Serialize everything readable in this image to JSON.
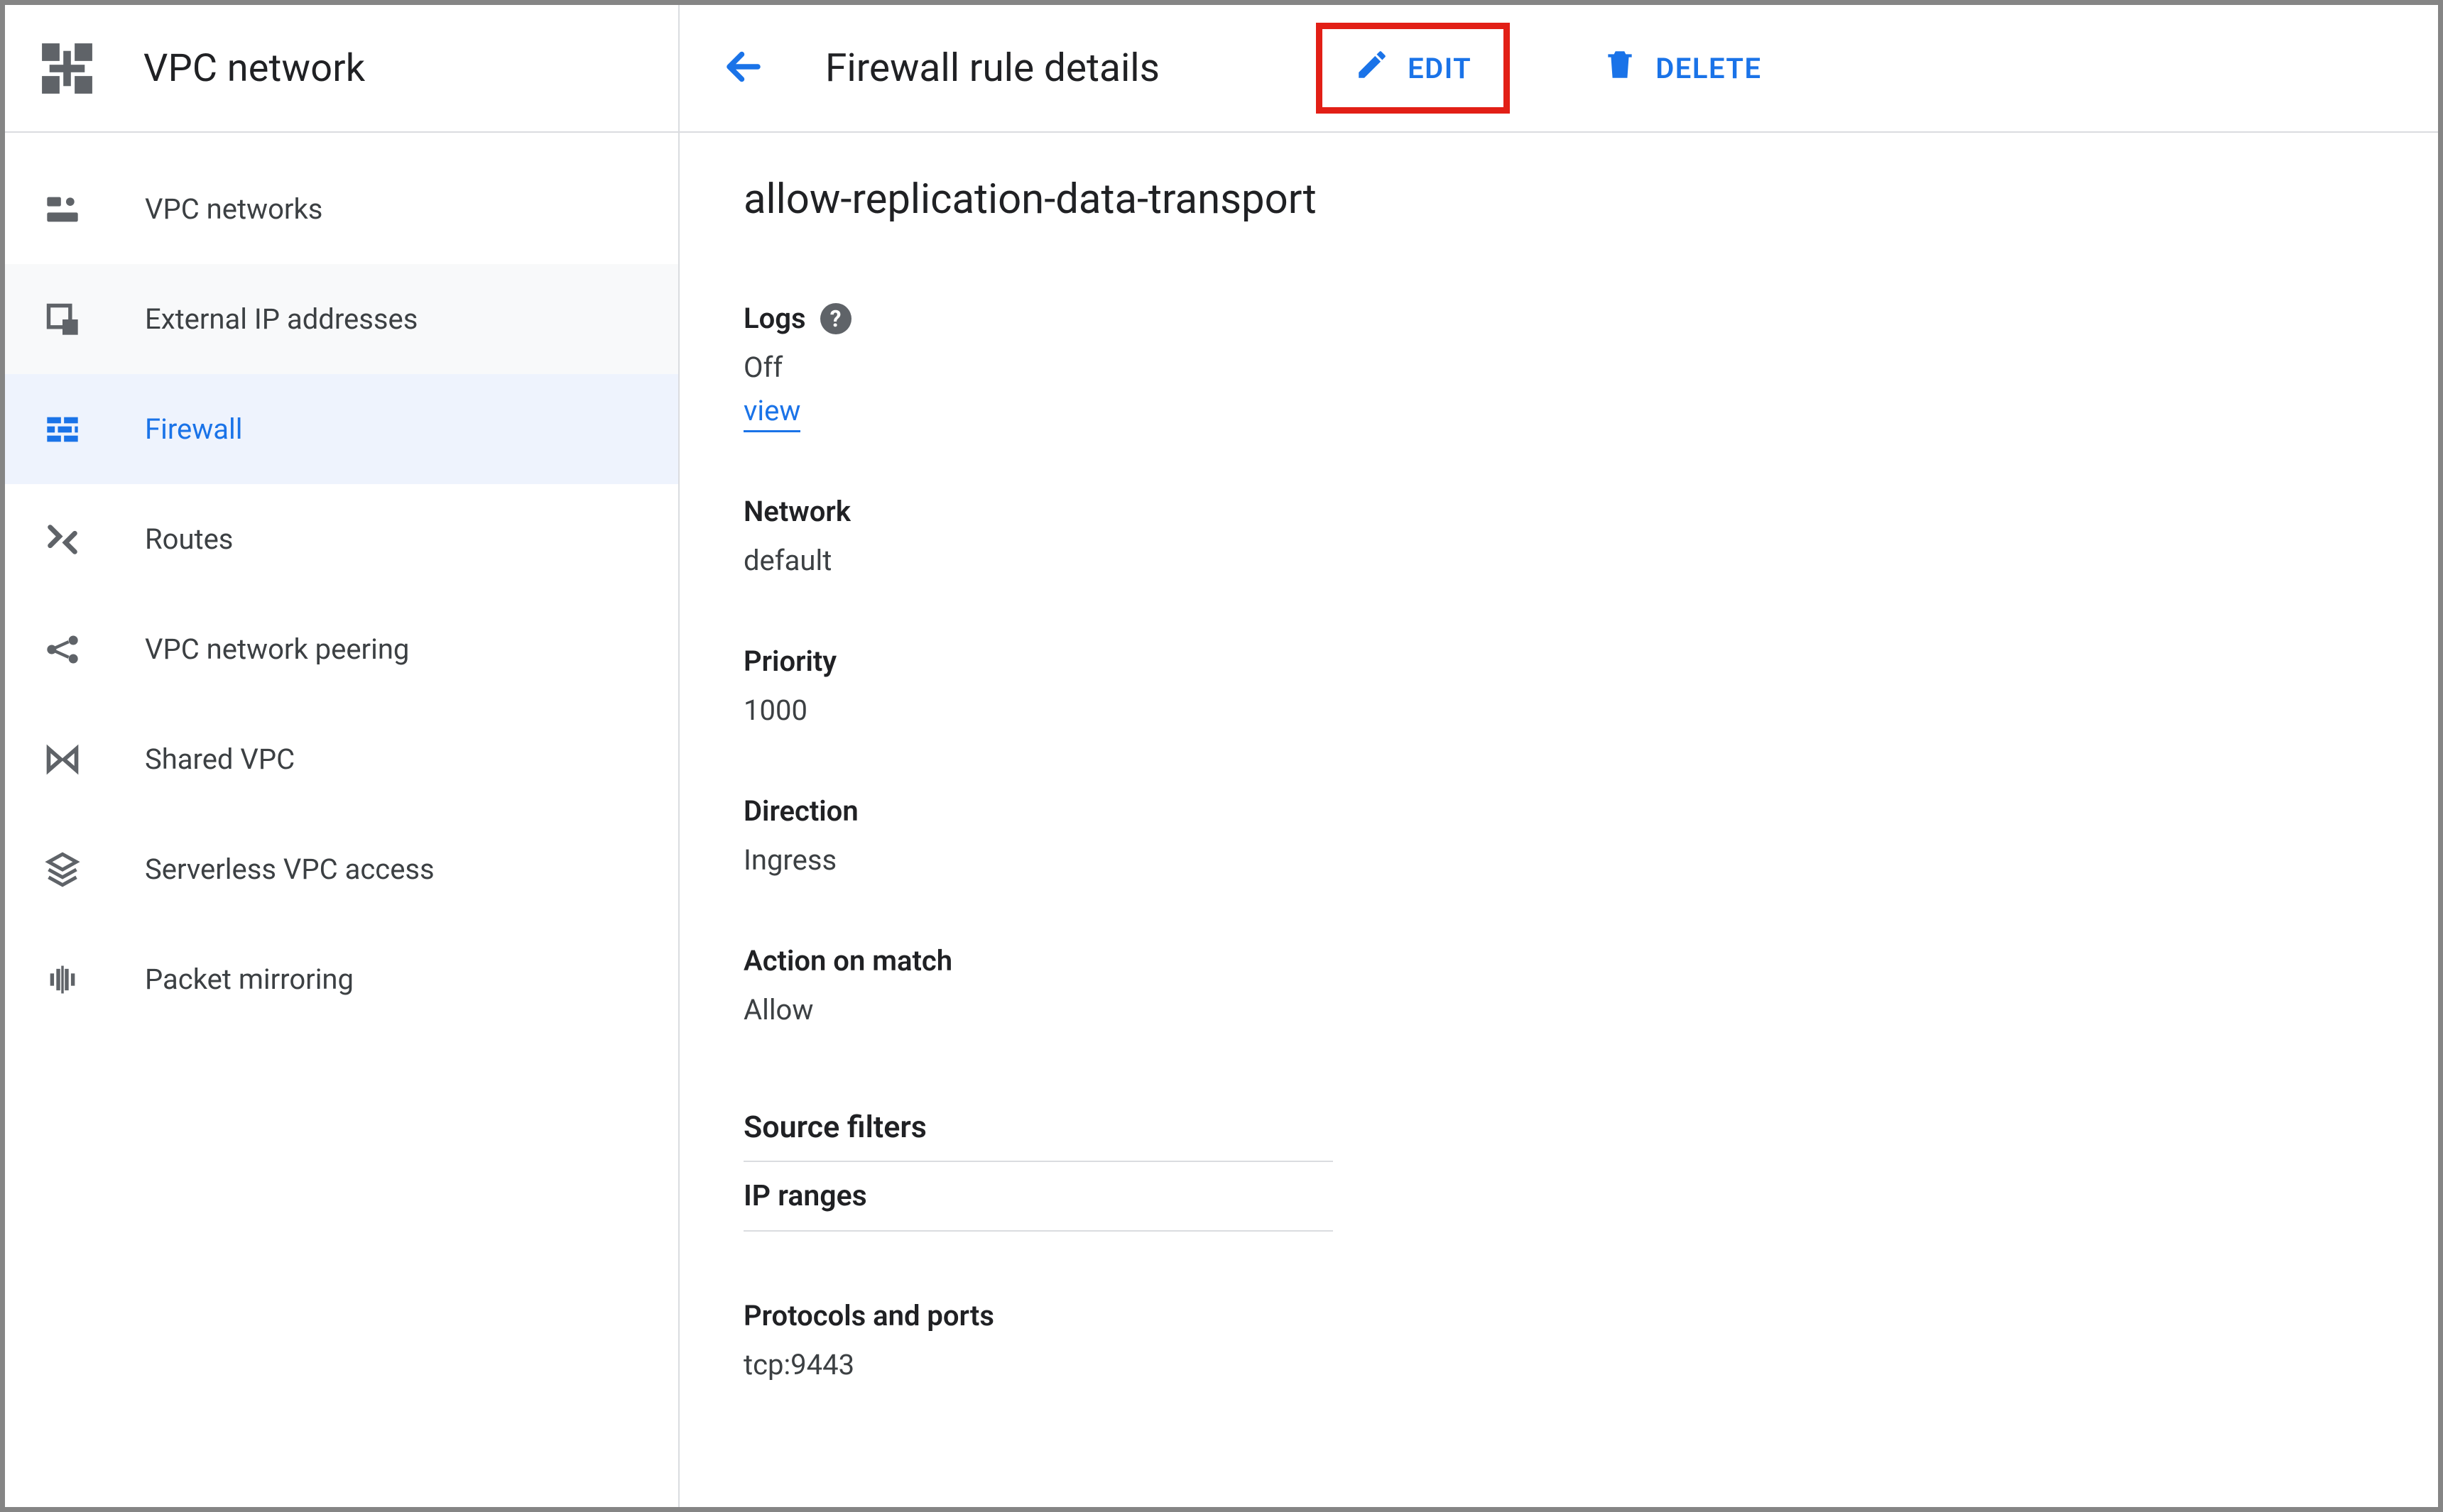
{
  "product": {
    "title": "VPC network"
  },
  "sidebar": {
    "items": [
      {
        "label": "VPC networks",
        "icon": "vpc-networks-icon"
      },
      {
        "label": "External IP addresses",
        "icon": "external-ip-icon"
      },
      {
        "label": "Firewall",
        "icon": "firewall-icon",
        "selected": true
      },
      {
        "label": "Routes",
        "icon": "routes-icon"
      },
      {
        "label": "VPC network peering",
        "icon": "peering-icon"
      },
      {
        "label": "Shared VPC",
        "icon": "shared-vpc-icon"
      },
      {
        "label": "Serverless VPC access",
        "icon": "serverless-icon"
      },
      {
        "label": "Packet mirroring",
        "icon": "packet-mirroring-icon"
      }
    ]
  },
  "header": {
    "page_title": "Firewall rule details",
    "actions": {
      "edit": {
        "label": "EDIT",
        "highlighted": true
      },
      "delete": {
        "label": "DELETE"
      }
    }
  },
  "rule": {
    "name": "allow-replication-data-transport",
    "logs": {
      "label": "Logs",
      "value": "Off",
      "link_text": "view"
    },
    "network": {
      "label": "Network",
      "value": "default"
    },
    "priority": {
      "label": "Priority",
      "value": "1000"
    },
    "direction": {
      "label": "Direction",
      "value": "Ingress"
    },
    "action": {
      "label": "Action on match",
      "value": "Allow"
    },
    "source_filters": {
      "heading": "Source filters",
      "rows": [
        "IP ranges"
      ]
    },
    "protocols": {
      "label": "Protocols and ports",
      "value": "tcp:9443"
    }
  }
}
